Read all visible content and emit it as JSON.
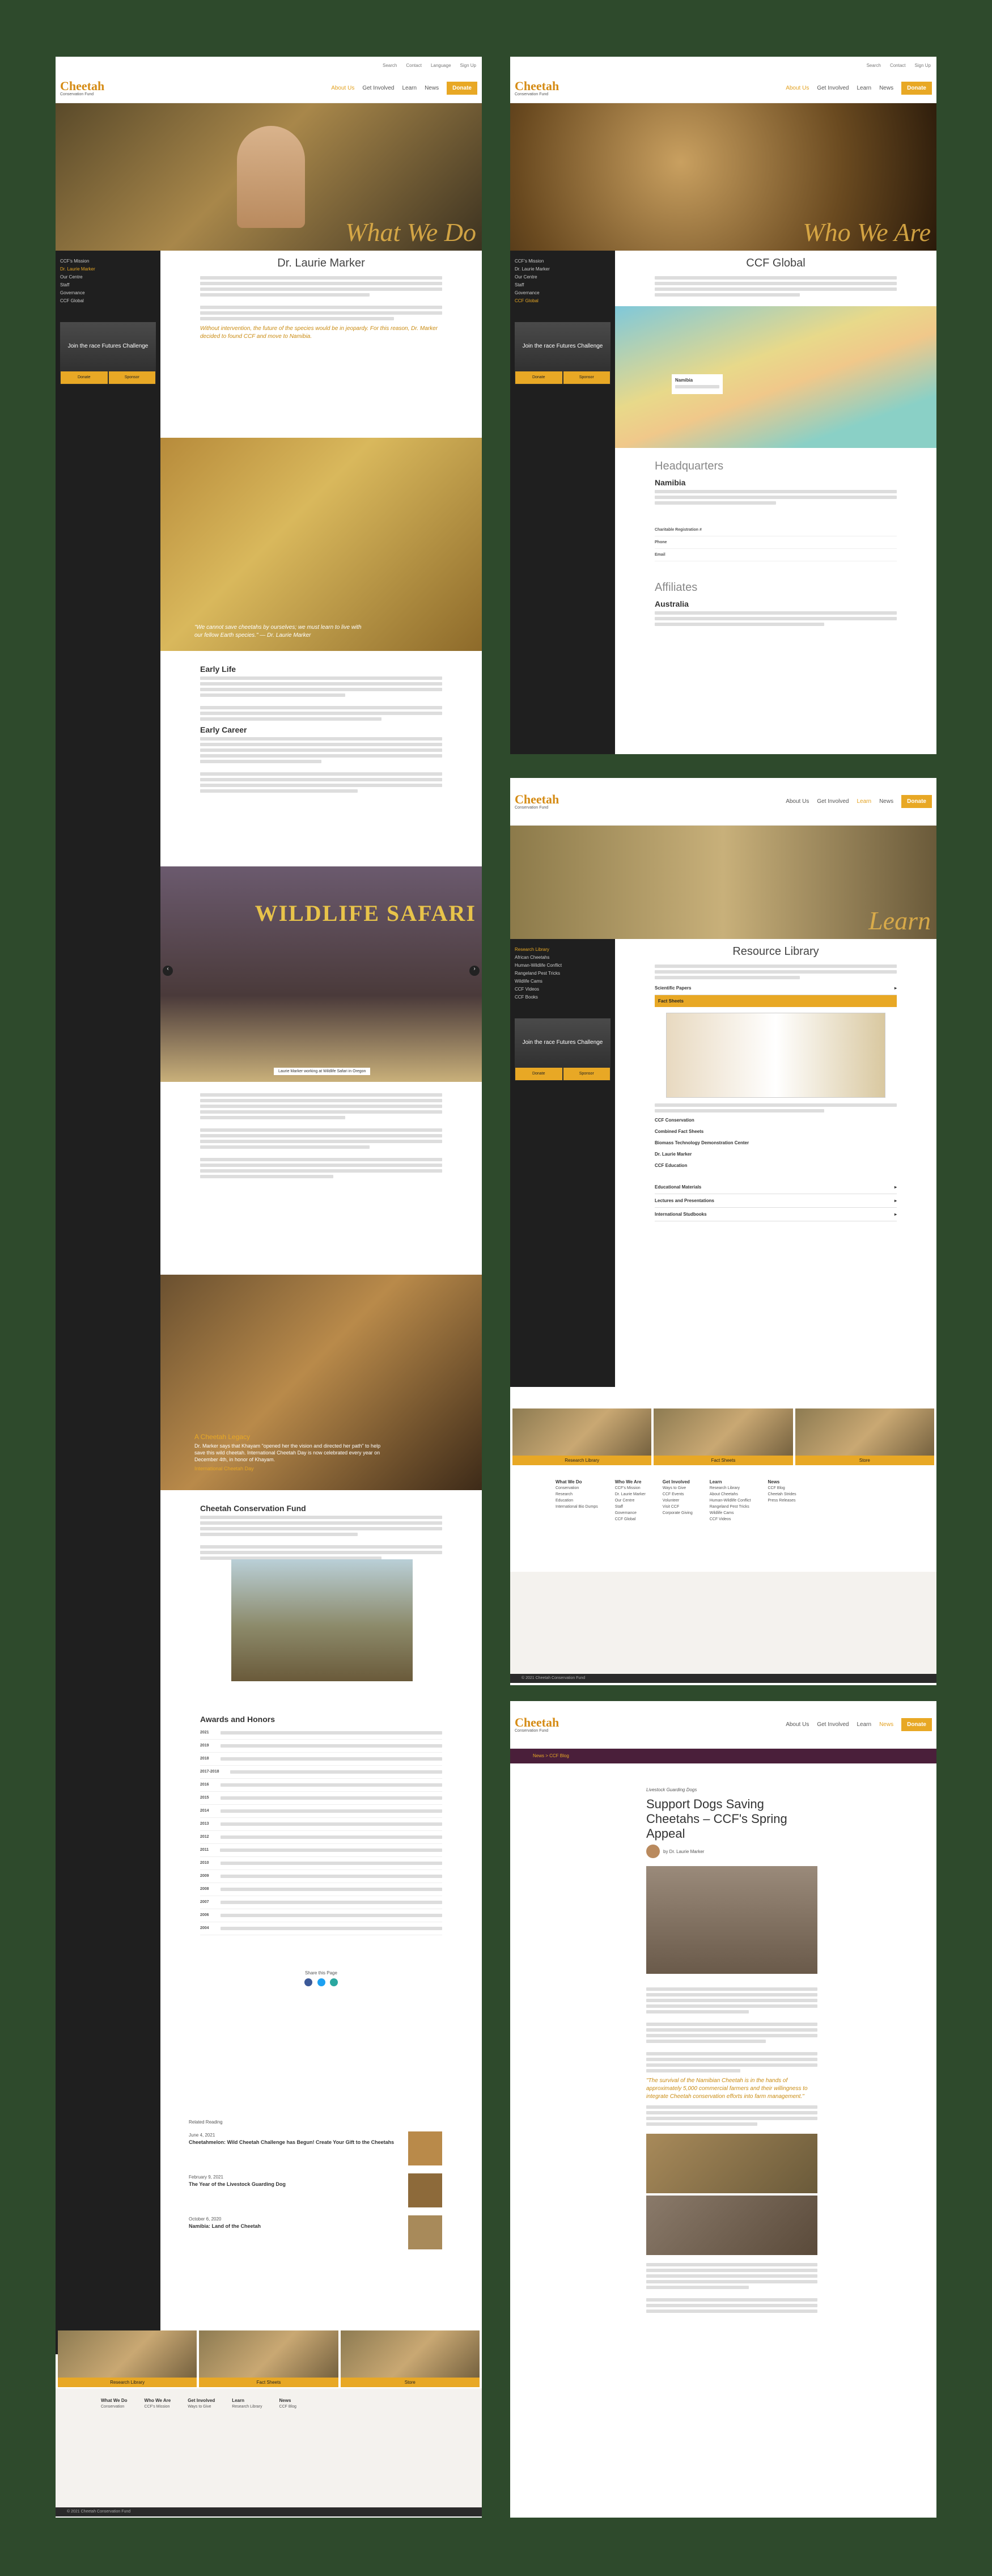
{
  "header": {
    "topbar": [
      "Search",
      "Contact",
      "Language",
      "Sign Up"
    ],
    "logo_main": "Cheetah",
    "logo_sub": "Conservation Fund",
    "menu": [
      "About Us",
      "Get Involved",
      "Learn",
      "News",
      "Donate"
    ]
  },
  "page1": {
    "hero_title": "What We Do",
    "sidebar": [
      "CCF's Mission",
      "Dr. Laurie Marker",
      "Our Centre",
      "Staff",
      "Governance",
      "CCF Global"
    ],
    "promo": "Join the race\nFutures Challenge",
    "promo_buttons": [
      "Donate",
      "Sponsor"
    ],
    "title": "Dr. Laurie Marker",
    "quote": "Without intervention, the future of the species would be in jeopardy. For this reason, Dr. Marker decided to found CCF and move to Namibia.",
    "photo_quote": "\"We cannot save cheetahs by ourselves; we must learn to live with our fellow Earth species.\" — Dr. Laurie Marker",
    "early_life": "Early Life",
    "early_career": "Early Career",
    "safari_sign": "WILDLIFE SAFARI",
    "caption": "Laurie Marker working at Wildlife Safari in Oregon",
    "legacy_title": "A Cheetah Legacy",
    "legacy_quote": "Dr. Marker says that Khayam \"opened her the vision and directed her path\" to help save this wild cheetah. International Cheetah Day is now celebrated every year on December 4th, in honor of Khayam.",
    "legacy_link": "International Cheetah Day",
    "ccf_title": "Cheetah Conservation Fund",
    "awards_title": "Awards and Honors",
    "awards": [
      "2021",
      "2019",
      "2018",
      "2017-2018",
      "2016",
      "2015",
      "2014",
      "2013",
      "2012",
      "2011",
      "2010",
      "2009",
      "2008",
      "2007",
      "2006",
      "2004"
    ],
    "share": "Share this Page",
    "related": "Related Reading",
    "related_items": [
      {
        "date": "June 4, 2021",
        "title": "Cheetahmelon: Wild Cheetah Challenge has Begun! Create Your Gift to the Cheetahs"
      },
      {
        "date": "February 9, 2021",
        "title": "The Year of the Livestock Guarding Dog"
      },
      {
        "date": "October 6, 2020",
        "title": "Namibia: Land of the Cheetah"
      }
    ],
    "foot_buttons": [
      "Research Library",
      "Fact Sheets",
      "Store"
    ]
  },
  "page2": {
    "hero_title": "Who We Are",
    "title": "CCF Global",
    "map_popup": "Namibia",
    "hq": "Headquarters",
    "namibia": "Namibia",
    "affiliates": "Affiliates",
    "australia": "Australia",
    "contact_rows": [
      "Charitable Registration #",
      "Phone",
      "Email"
    ]
  },
  "page3": {
    "hero_title": "Learn",
    "sidebar": [
      "Research Library",
      "African Cheetahs",
      "Human-Wildlife Conflict",
      "Rangeland Pest Tricks",
      "Wildlife Cams",
      "CCF Videos",
      "CCF Books"
    ],
    "title": "Resource Library",
    "sections": [
      "Scientific Papers",
      "Fact Sheets",
      "Educational Materials",
      "Lectures and Presentations",
      "International Studbooks"
    ],
    "fact_items": [
      "CCF Conservation",
      "Combined Fact Sheets",
      "Biomass Technology Demonstration Center",
      "Dr. Laurie Marker",
      "CCF Education"
    ],
    "foot_buttons": [
      "Research Library",
      "Fact Sheets",
      "Store"
    ],
    "footer_cols": [
      {
        "title": "What We Do",
        "items": [
          "Conservation",
          "Research",
          "Education",
          "International Bio Dumps"
        ]
      },
      {
        "title": "Who We Are",
        "items": [
          "CCF's Mission",
          "Dr. Laurie Marker",
          "Our Centre",
          "Staff",
          "Governance",
          "CCF Global"
        ]
      },
      {
        "title": "Get Involved",
        "items": [
          "Ways to Give",
          "CCF Events",
          "Volunteer",
          "Visit CCF",
          "Corporate Giving"
        ]
      },
      {
        "title": "Learn",
        "items": [
          "Research Library",
          "About Cheetahs",
          "Human-Wildlife Conflict",
          "Rangeland Pest Tricks",
          "Wildlife Cams",
          "CCF Videos"
        ]
      },
      {
        "title": "News",
        "items": [
          "CCF Blog",
          "Cheetah Strides",
          "Press Releases"
        ]
      }
    ],
    "copyright": "© 2021 Cheetah Conservation Fund"
  },
  "page4": {
    "breadcrumb": "News > CCF Blog",
    "kicker": "Livestock Guarding Dogs",
    "title": "Support Dogs Saving Cheetahs – CCF's Spring Appeal",
    "author": "by Dr. Laurie Marker",
    "pull_quote": "\"The survival of the Namibian Cheetah is in the hands of approximately 5,000 commercial farmers and their willingness to integrate Cheetah conservation efforts into farm management.\""
  },
  "colors": {
    "accent": "#e8a825",
    "sidebar": "#1f1f1f",
    "background": "#2e4a2c"
  }
}
